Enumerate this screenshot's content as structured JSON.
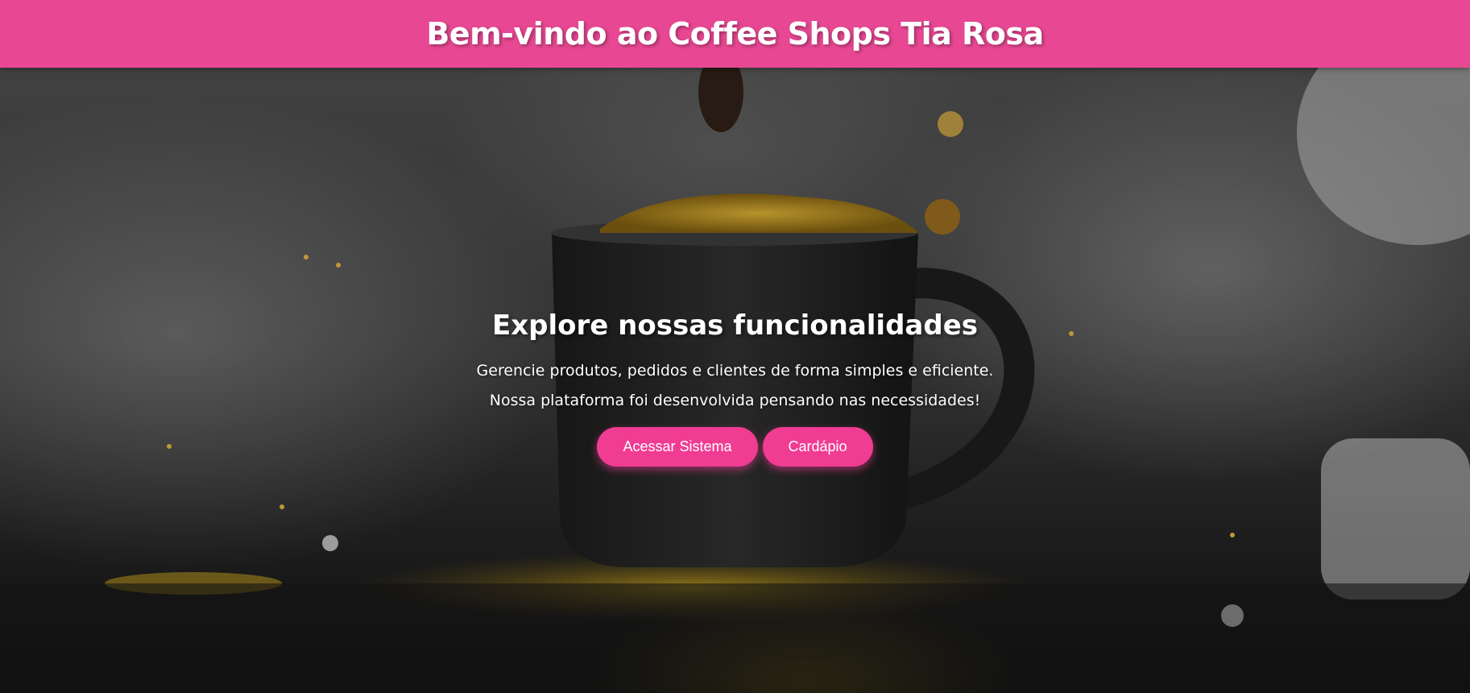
{
  "header": {
    "title": "Bem-vindo ao Coffee Shops Tia Rosa"
  },
  "hero": {
    "background_image": "coffee-cup-splash-photo",
    "heading": "Explore nossas funcionalidades",
    "lines": [
      "Gerencie produtos, pedidos e clientes de forma simples e eficiente.",
      "Nossa plataforma foi desenvolvida pensando nas necessidades!"
    ],
    "buttons": {
      "access_label": "Acessar Sistema",
      "menu_label": "Cardápio"
    }
  },
  "colors": {
    "header": "#e84893",
    "button": "#f03c93",
    "text": "#ffffff"
  }
}
